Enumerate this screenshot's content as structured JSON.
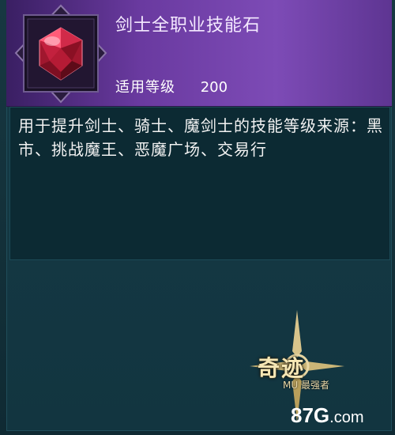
{
  "item": {
    "name": "剑士全职业技能石",
    "level_label": "适用等级",
    "level_value": "200",
    "description": "用于提升剑士、骑士、魔剑士的技能等级来源：黑市、挑战魔王、恶魔广场、交易行",
    "icon": "red-gem-icon"
  },
  "branding": {
    "game_logo": "奇迹 MU 最强者",
    "watermark": "87G.com"
  },
  "colors": {
    "header": "#6a3aa0",
    "panel": "#123540",
    "text": "#f2f2f2"
  }
}
